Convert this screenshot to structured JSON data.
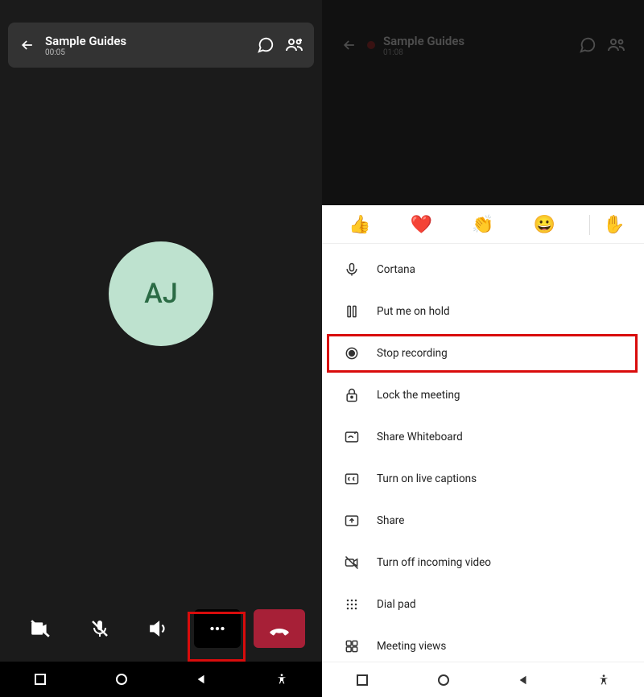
{
  "left": {
    "title": "Sample Guides",
    "time": "00:05",
    "avatar": "AJ"
  },
  "right": {
    "title": "Sample Guides",
    "time": "01:08"
  },
  "reactions": {
    "like": "👍",
    "heart": "❤️",
    "applause": "👏",
    "laugh": "😀",
    "raise_hand": "✋"
  },
  "menu": {
    "cortana": "Cortana",
    "hold": "Put me on hold",
    "stop_rec": "Stop recording",
    "lock": "Lock the meeting",
    "whiteboard": "Share Whiteboard",
    "captions": "Turn on live captions",
    "share": "Share",
    "video_off": "Turn off incoming video",
    "dial": "Dial pad",
    "views": "Meeting views"
  }
}
